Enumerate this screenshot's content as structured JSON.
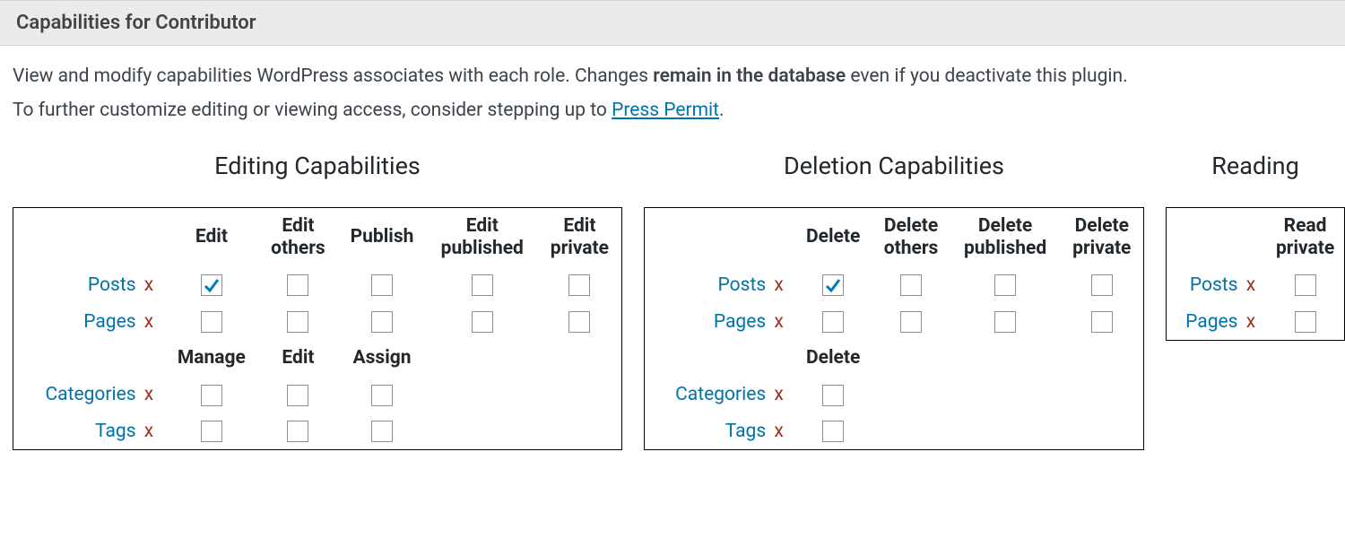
{
  "header": {
    "title": "Capabilities for Contributor"
  },
  "intro": {
    "line1_pre": "View and modify capabilities WordPress associates with each role. Changes ",
    "line1_bold": "remain in the database",
    "line1_post": " even if you deactivate this plugin.",
    "line2_pre": "To further customize editing or viewing access, consider stepping up to ",
    "line2_link": "Press Permit",
    "line2_post": "."
  },
  "labels": {
    "x": "x"
  },
  "groups": {
    "editing": {
      "title": "Editing Capabilities",
      "cols_posts": [
        "Edit",
        "Edit others",
        "Publish",
        "Edit published",
        "Edit private"
      ],
      "cols_terms": [
        "Manage",
        "Edit",
        "Assign"
      ],
      "rows_posts": [
        {
          "label": "Posts",
          "caps": [
            true,
            false,
            false,
            false,
            false
          ]
        },
        {
          "label": "Pages",
          "caps": [
            false,
            false,
            false,
            false,
            false
          ]
        }
      ],
      "rows_terms": [
        {
          "label": "Categories",
          "caps": [
            false,
            false,
            false
          ]
        },
        {
          "label": "Tags",
          "caps": [
            false,
            false,
            false
          ]
        }
      ]
    },
    "deletion": {
      "title": "Deletion Capabilities",
      "cols_posts": [
        "Delete",
        "Delete others",
        "Delete published",
        "Delete private"
      ],
      "cols_terms": [
        "Delete"
      ],
      "rows_posts": [
        {
          "label": "Posts",
          "caps": [
            true,
            false,
            false,
            false
          ]
        },
        {
          "label": "Pages",
          "caps": [
            false,
            false,
            false,
            false
          ]
        }
      ],
      "rows_terms": [
        {
          "label": "Categories",
          "caps": [
            false
          ]
        },
        {
          "label": "Tags",
          "caps": [
            false
          ]
        }
      ]
    },
    "reading": {
      "title": "Reading",
      "cols_posts": [
        "Read private"
      ],
      "rows_posts": [
        {
          "label": "Posts",
          "caps": [
            false
          ]
        },
        {
          "label": "Pages",
          "caps": [
            false
          ]
        }
      ]
    }
  }
}
